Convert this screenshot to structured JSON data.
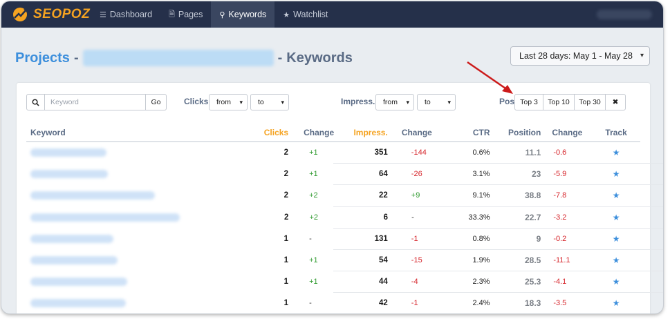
{
  "navbar": {
    "brand": "SEOPOZ",
    "items": [
      {
        "label": "Dashboard",
        "icon": "menu-icon",
        "glyph": "☰",
        "active": false
      },
      {
        "label": "Pages",
        "icon": "file-icon",
        "glyph": "🗎",
        "active": false
      },
      {
        "label": "Keywords",
        "icon": "key-icon",
        "glyph": "⚲",
        "active": true
      },
      {
        "label": "Watchlist",
        "icon": "star-icon",
        "glyph": "★",
        "active": false
      }
    ]
  },
  "header": {
    "title_prefix": "Projects",
    "separator": "-",
    "title_suffix": "Keywords",
    "date_range": "Last 28 days: May 1 - May 28"
  },
  "filters": {
    "search_placeholder": "Keyword",
    "go_label": "Go",
    "clicks_label": "Clicks",
    "impress_label": "Impress.",
    "pos_label": "Pos",
    "from_label": "from",
    "to_label": "to",
    "position_buttons": [
      "Top 3",
      "Top 10",
      "Top 30"
    ],
    "clear_glyph": "✖"
  },
  "table": {
    "headers": {
      "keyword": "Keyword",
      "clicks": "Clicks",
      "change1": "Change",
      "impress": "Impress.",
      "change2": "Change",
      "ctr": "CTR",
      "position": "Position",
      "change3": "Change",
      "track": "Track"
    },
    "rows": [
      {
        "clicks": "2",
        "clicks_change": "+1",
        "impress": "351",
        "impress_change": "-144",
        "ctr": "0.6%",
        "position": "11.1",
        "position_change": "-0.6"
      },
      {
        "clicks": "2",
        "clicks_change": "+1",
        "impress": "64",
        "impress_change": "-26",
        "ctr": "3.1%",
        "position": "23",
        "position_change": "-5.9"
      },
      {
        "clicks": "2",
        "clicks_change": "+2",
        "impress": "22",
        "impress_change": "+9",
        "ctr": "9.1%",
        "position": "38.8",
        "position_change": "-7.8"
      },
      {
        "clicks": "2",
        "clicks_change": "+2",
        "impress": "6",
        "impress_change": "-",
        "ctr": "33.3%",
        "position": "22.7",
        "position_change": "-3.2"
      },
      {
        "clicks": "1",
        "clicks_change": "-",
        "impress": "131",
        "impress_change": "-1",
        "ctr": "0.8%",
        "position": "9",
        "position_change": "-0.2"
      },
      {
        "clicks": "1",
        "clicks_change": "+1",
        "impress": "54",
        "impress_change": "-15",
        "ctr": "1.9%",
        "position": "28.5",
        "position_change": "-11.1"
      },
      {
        "clicks": "1",
        "clicks_change": "+1",
        "impress": "44",
        "impress_change": "-4",
        "ctr": "2.3%",
        "position": "25.3",
        "position_change": "-4.1"
      },
      {
        "clicks": "1",
        "clicks_change": "-",
        "impress": "42",
        "impress_change": "-1",
        "ctr": "2.4%",
        "position": "18.3",
        "position_change": "-3.5"
      }
    ],
    "track_glyph": "★"
  },
  "colors": {
    "navbar": "#25304a",
    "brand": "#f5a321",
    "link": "#3d8fdc",
    "positive": "#2e9a2e",
    "negative": "#d6252b",
    "annotation_arrow": "#cc1b1b"
  }
}
